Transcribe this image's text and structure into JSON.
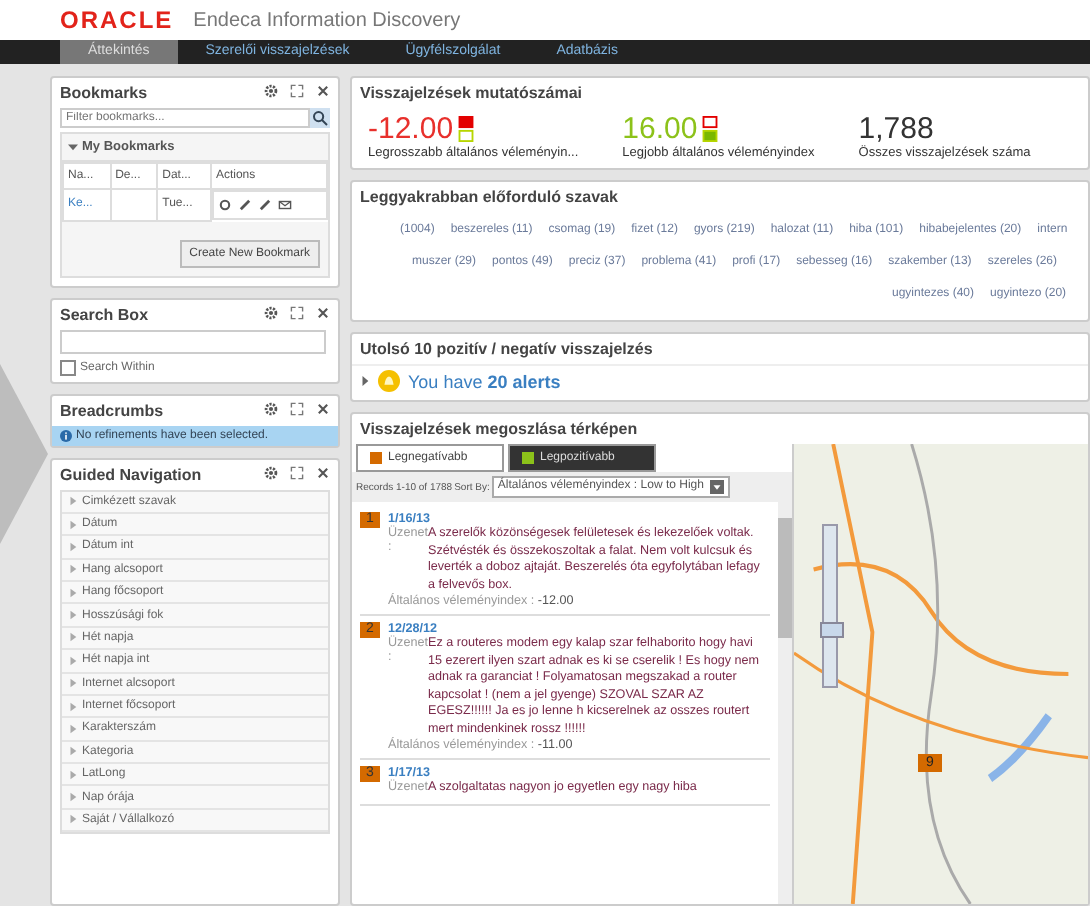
{
  "header": {
    "logo": "ORACLE",
    "product": "Endeca Information Discovery"
  },
  "tabs": [
    {
      "label": "Áttekintés",
      "selected": true
    },
    {
      "label": "Szerelői visszajelzések",
      "selected": false
    },
    {
      "label": "Ügyfélszolgálat",
      "selected": false
    },
    {
      "label": "Adatbázis",
      "selected": false
    }
  ],
  "bookmarks": {
    "title": "Bookmarks",
    "filter_placeholder": "Filter bookmarks...",
    "group": "My Bookmarks",
    "expanded": true,
    "columns": [
      "Na...",
      "De...",
      "Dat...",
      "Actions"
    ],
    "rows": [
      {
        "name": "Ke...",
        "description": "",
        "date": "Tue..."
      }
    ],
    "button": "Create New Bookmark"
  },
  "search_box": {
    "title": "Search Box",
    "search_within": {
      "label": "Search Within",
      "checked": false
    }
  },
  "breadcrumbs": {
    "title": "Breadcrumbs",
    "message": "No refinements have been selected."
  },
  "guided_navigation": {
    "title": "Guided Navigation",
    "items": [
      "Cimkézett szavak",
      "Dátum",
      "Dátum int",
      "Hang alcsoport",
      "Hang főcsoport",
      "Hosszúsági fok",
      "Hét napja",
      "Hét napja int",
      "Internet alcsoport",
      "Internet főcsoport",
      "Karakterszám",
      "Kategoria",
      "LatLong",
      "Nap órája",
      "Saját / Vállalkozó"
    ]
  },
  "metrics": {
    "title": "Visszajelzések mutatószámai",
    "items": [
      {
        "value": "-12.00",
        "label": "Legrosszabb általános véleményin...",
        "kind": "negative"
      },
      {
        "value": "16.00",
        "label": "Legjobb általános véleményindex",
        "kind": "positive"
      },
      {
        "value": "1,788",
        "label": "Összes visszajelzések száma",
        "kind": "count"
      }
    ]
  },
  "word_cloud": {
    "title": "Leggyakrabban előforduló szavak",
    "lines": [
      [
        "(1004)",
        "beszereles (11)",
        "csomag (19)",
        "fizet (12)",
        "gyors (219)",
        "halozat (11)",
        "hiba (101)",
        "hibabejelentes (20)",
        "intern"
      ],
      [
        "muszer (29)",
        "pontos (49)",
        "preciz (37)",
        "problema (41)",
        "profi (17)",
        "sebesseg (16)",
        "szakember (13)",
        "szereles (26)"
      ],
      [
        "ugyintezes (40)",
        "ugyintezo (20)"
      ]
    ]
  },
  "alerts": {
    "title": "Utolsó 10 pozitív / negatív visszajelzés",
    "text": "You have **20 alerts**",
    "expanded": false
  },
  "map_panel": {
    "title": "Visszajelzések megoszlása térképen",
    "tabs": [
      {
        "label": "Legnegatívabb",
        "selected": true,
        "color": "#d46a00"
      },
      {
        "label": "Legpozitívabb",
        "selected": false,
        "color": "#8cc21a"
      }
    ],
    "records_info": "Records 1-10 of 1788",
    "sort_label": "Sort By:",
    "sort_value": "Általános véleményindex : Low to High",
    "records": [
      {
        "rank": "1",
        "date": "1/16/13",
        "message_label": "Üzenet :",
        "message": "A szerelők közönségesek felületesek és lekezelőek voltak. Szétvésték és összekoszoltak a falat. Nem volt kulcsuk és leverték a doboz ajtaját. Beszerelés óta egyfolytában lefagy a felvevős box.",
        "score_label": "Általános véleményindex :",
        "score": "-12.00"
      },
      {
        "rank": "2",
        "date": "12/28/12",
        "message_label": "Üzenet :",
        "message": "Ez a routeres modem egy kalap szar felhaborito hogy havi 15 ezerert ilyen szart adnak es ki se cserelik ! Es hogy nem adnak ra garanciat ! Folyamatosan megszakad a router kapcsolat ! (nem a jel gyenge) SZOVAL SZAR AZ EGESZ!!!!!! Ja es jo lenne h kicserelnek az osszes routert mert mindenkinek rossz !!!!!!",
        "score_label": "Általános véleményindex :",
        "score": "-11.00"
      },
      {
        "rank": "3",
        "date": "1/17/13",
        "message_label": "Üzenet",
        "message": "A szolgaltatas nagyon jo egyetlen egy nagy hiba"
      }
    ],
    "map_marker": "9",
    "zoom": {
      "level": 0.3
    }
  }
}
